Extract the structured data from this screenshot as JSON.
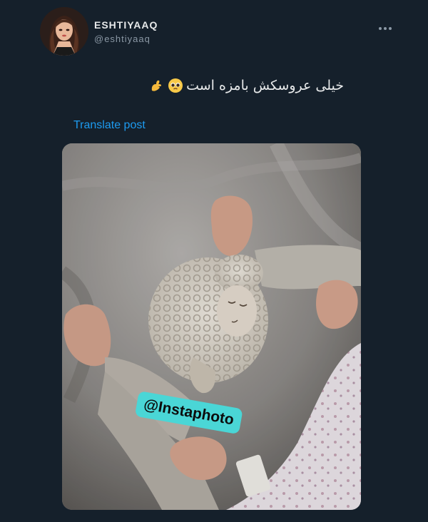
{
  "user": {
    "display_name": "ESHTIYAAQ",
    "handle": "@eshtiyaaq"
  },
  "tweet": {
    "text": "خیلی عروسکش بامزه است",
    "emojis": [
      "pleading-face-emoji",
      "pinching-hand-emoji"
    ],
    "translate_label": "Translate post"
  },
  "media": {
    "watermark": "@Instaphoto"
  },
  "colors": {
    "background": "#15202b",
    "link": "#1d9bf0",
    "secondary_text": "#8b98a5",
    "watermark_bg": "#4ad6d6"
  },
  "icons": [
    "more-options-icon"
  ]
}
